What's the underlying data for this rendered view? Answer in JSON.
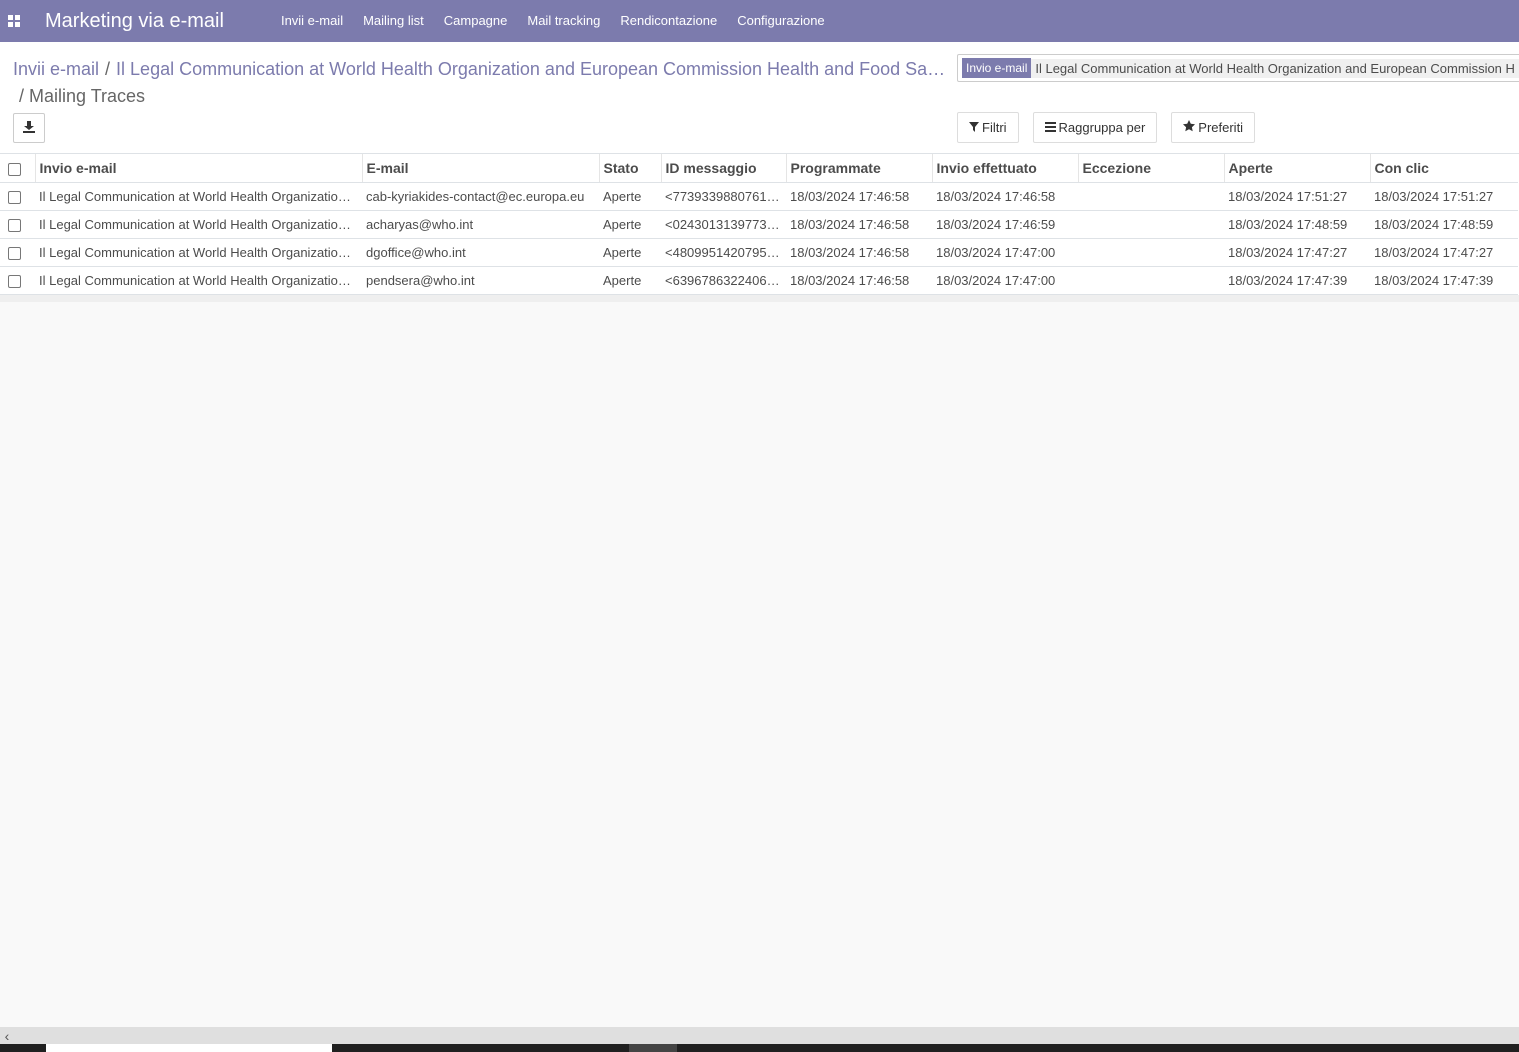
{
  "navbar": {
    "apps_icon": "apps-grid-icon",
    "brand": "Marketing via e-mail",
    "menu": [
      "Invii e-mail",
      "Mailing list",
      "Campagne",
      "Mail tracking",
      "Rendicontazione",
      "Configurazione"
    ],
    "color": "#7c7bad"
  },
  "breadcrumb": {
    "root": "Invii e-mail",
    "separator": "/",
    "mailing": "Il Legal Communication at World Health Organization and European Commission Health and Food Sa…",
    "current": "/ Mailing Traces"
  },
  "search": {
    "facet_label": "Invio e-mail",
    "facet_value": "Il Legal Communication at World Health Organization and European Commission H"
  },
  "toolbar": {
    "export_icon": "download-icon",
    "filters": "Filtri",
    "group_by": "Raggruppa per",
    "favorites": "Preferiti"
  },
  "table": {
    "columns": [
      "Invio e-mail",
      "E-mail",
      "Stato",
      "ID messaggio",
      "Programmate",
      "Invio effettuato",
      "Eccezione",
      "Aperte",
      "Con clic"
    ],
    "rows": [
      [
        "Il Legal Communication at World Health Organization…",
        "cab-kyriakides-contact@ec.europa.eu",
        "Aperte",
        "<7739339880761…",
        "18/03/2024 17:46:58",
        "18/03/2024 17:46:58",
        "",
        "18/03/2024 17:51:27",
        "18/03/2024 17:51:27"
      ],
      [
        "Il Legal Communication at World Health Organization…",
        "acharyas@who.int",
        "Aperte",
        "<0243013139773…",
        "18/03/2024 17:46:58",
        "18/03/2024 17:46:59",
        "",
        "18/03/2024 17:48:59",
        "18/03/2024 17:48:59"
      ],
      [
        "Il Legal Communication at World Health Organization…",
        "dgoffice@who.int",
        "Aperte",
        "<4809951420795…",
        "18/03/2024 17:46:58",
        "18/03/2024 17:47:00",
        "",
        "18/03/2024 17:47:27",
        "18/03/2024 17:47:27"
      ],
      [
        "Il Legal Communication at World Health Organization…",
        "pendsera@who.int",
        "Aperte",
        "<6396786322406…",
        "18/03/2024 17:46:58",
        "18/03/2024 17:47:00",
        "",
        "18/03/2024 17:47:39",
        "18/03/2024 17:47:39"
      ]
    ]
  },
  "scrollbar": {
    "left_arrow": "‹"
  }
}
